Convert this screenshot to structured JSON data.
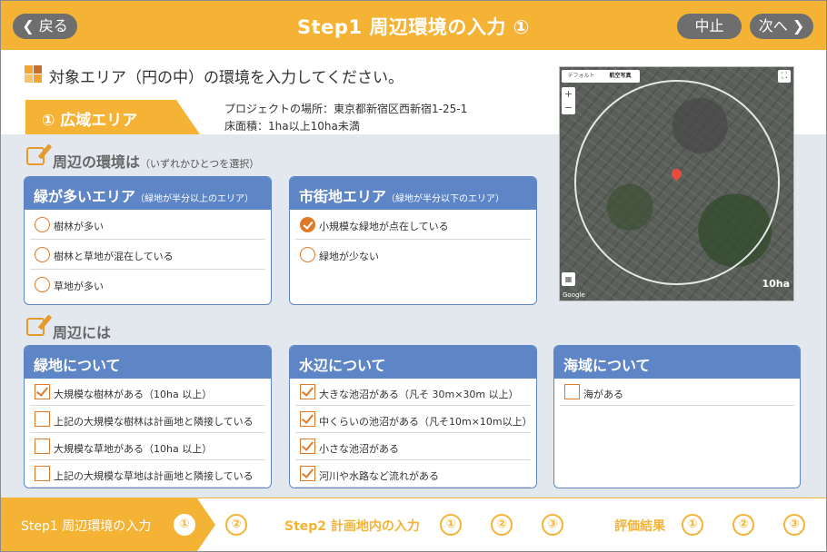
{
  "header": {
    "back_label": "戻る",
    "title": "Step1 周辺環境の入力 ①",
    "stop_label": "中止",
    "next_label": "次へ"
  },
  "instruction": "対象エリア（円の中）の環境を入力してください。",
  "tab": {
    "label": "① 広域エリア"
  },
  "project": {
    "location": "プロジェクトの場所：東京都新宿区西新宿1-25-1",
    "area": "床面積：1ha以上10ha未満"
  },
  "surroundings": {
    "title": "周辺の環境は",
    "hint": "（いずれかひとつを選択）",
    "panels": [
      {
        "title": "緑が多いエリア",
        "note": "（緑地が半分以上のエリア）",
        "options": [
          {
            "label": "樹林が多い",
            "checked": false
          },
          {
            "label": "樹林と草地が混在している",
            "checked": false
          },
          {
            "label": "草地が多い",
            "checked": false
          }
        ]
      },
      {
        "title": "市街地エリア",
        "note": "（緑地が半分以下のエリア）",
        "options": [
          {
            "label": "小規模な緑地が点在している",
            "checked": true
          },
          {
            "label": "緑地が少ない",
            "checked": false
          }
        ]
      }
    ]
  },
  "nearby": {
    "title": "周辺には",
    "panels": [
      {
        "title": "緑地について",
        "items": [
          {
            "label": "大規模な樹林がある（10ha 以上）",
            "checked": true
          },
          {
            "label": "上記の大規模な樹林は計画地と隣接している",
            "checked": false
          },
          {
            "label": "大規模な草地がある（10ha 以上）",
            "checked": false
          },
          {
            "label": "上記の大規模な草地は計画地と隣接している",
            "checked": false
          }
        ]
      },
      {
        "title": "水辺について",
        "items": [
          {
            "label": "大きな池沼がある（凡そ 30m×30m 以上）",
            "checked": true
          },
          {
            "label": "中くらいの池沼がある（凡そ10m×10m以上）",
            "checked": true
          },
          {
            "label": "小さな池沼がある",
            "checked": true
          },
          {
            "label": "河川や水路など流れがある",
            "checked": true
          }
        ]
      },
      {
        "title": "海域について",
        "items": [
          {
            "label": "海がある",
            "checked": false
          }
        ]
      }
    ]
  },
  "map": {
    "toggle_map": "デフォルト",
    "toggle_sat": "航空写真",
    "zoom_in": "+",
    "zoom_out": "−",
    "scale_label": "10ha",
    "logo": "Google"
  },
  "footer": {
    "step1_label": "Step1 周辺環境の入力",
    "step1_nums": [
      "①",
      "②"
    ],
    "step2_label": "Step2 計画地内の入力",
    "step2_nums": [
      "①",
      "②",
      "③"
    ],
    "result_label": "評価結果",
    "result_nums": [
      "①",
      "②",
      "③"
    ]
  },
  "colors": {
    "accent": "#f5b335",
    "panel_blue": "#5e86c6",
    "check_orange": "#e07a2b",
    "button_gray": "#6e6e6e",
    "background_gray": "#e3e8ef"
  }
}
